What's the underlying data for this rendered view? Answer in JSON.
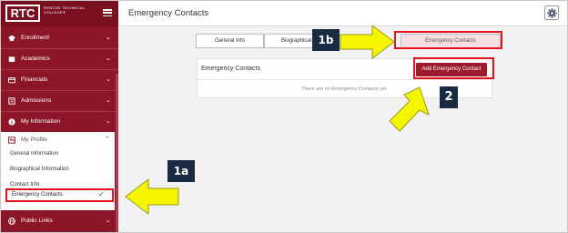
{
  "brand": {
    "logo": "RTC",
    "name": "RENTON TECHNICAL COLLEGE®"
  },
  "sidebar": {
    "items": [
      {
        "label": "Enrollment",
        "icon": "graduation-cap-icon"
      },
      {
        "label": "Academics",
        "icon": "book-icon"
      },
      {
        "label": "Financials",
        "icon": "credit-card-icon"
      },
      {
        "label": "Admissions",
        "icon": "form-icon"
      },
      {
        "label": "My Information",
        "icon": "info-icon"
      }
    ],
    "profile": {
      "label": "My Profile",
      "icon": "id-card-icon",
      "subitems": [
        "General Information",
        "Biographical Information",
        "Contact Info",
        "Emergency Contacts"
      ]
    },
    "bottom_item": {
      "label": "Public Links",
      "icon": "globe-icon"
    }
  },
  "header": {
    "title": "Emergency Contacts",
    "settings_icon": "gear-icon"
  },
  "tabs": [
    "General Info",
    "Biographical",
    "Emergency Contacts"
  ],
  "card": {
    "title": "Emergency Contacts",
    "add_button": "Add Emergency Contact",
    "empty_text": "There are no Emergency Contacts yet."
  },
  "callouts": {
    "c1a": "1a",
    "c1b": "1b",
    "c2": "2"
  },
  "colors": {
    "brand": "#8c1628",
    "highlight": "#e8101c",
    "arrow": "#f5f500",
    "callout": "#1a2a42"
  }
}
